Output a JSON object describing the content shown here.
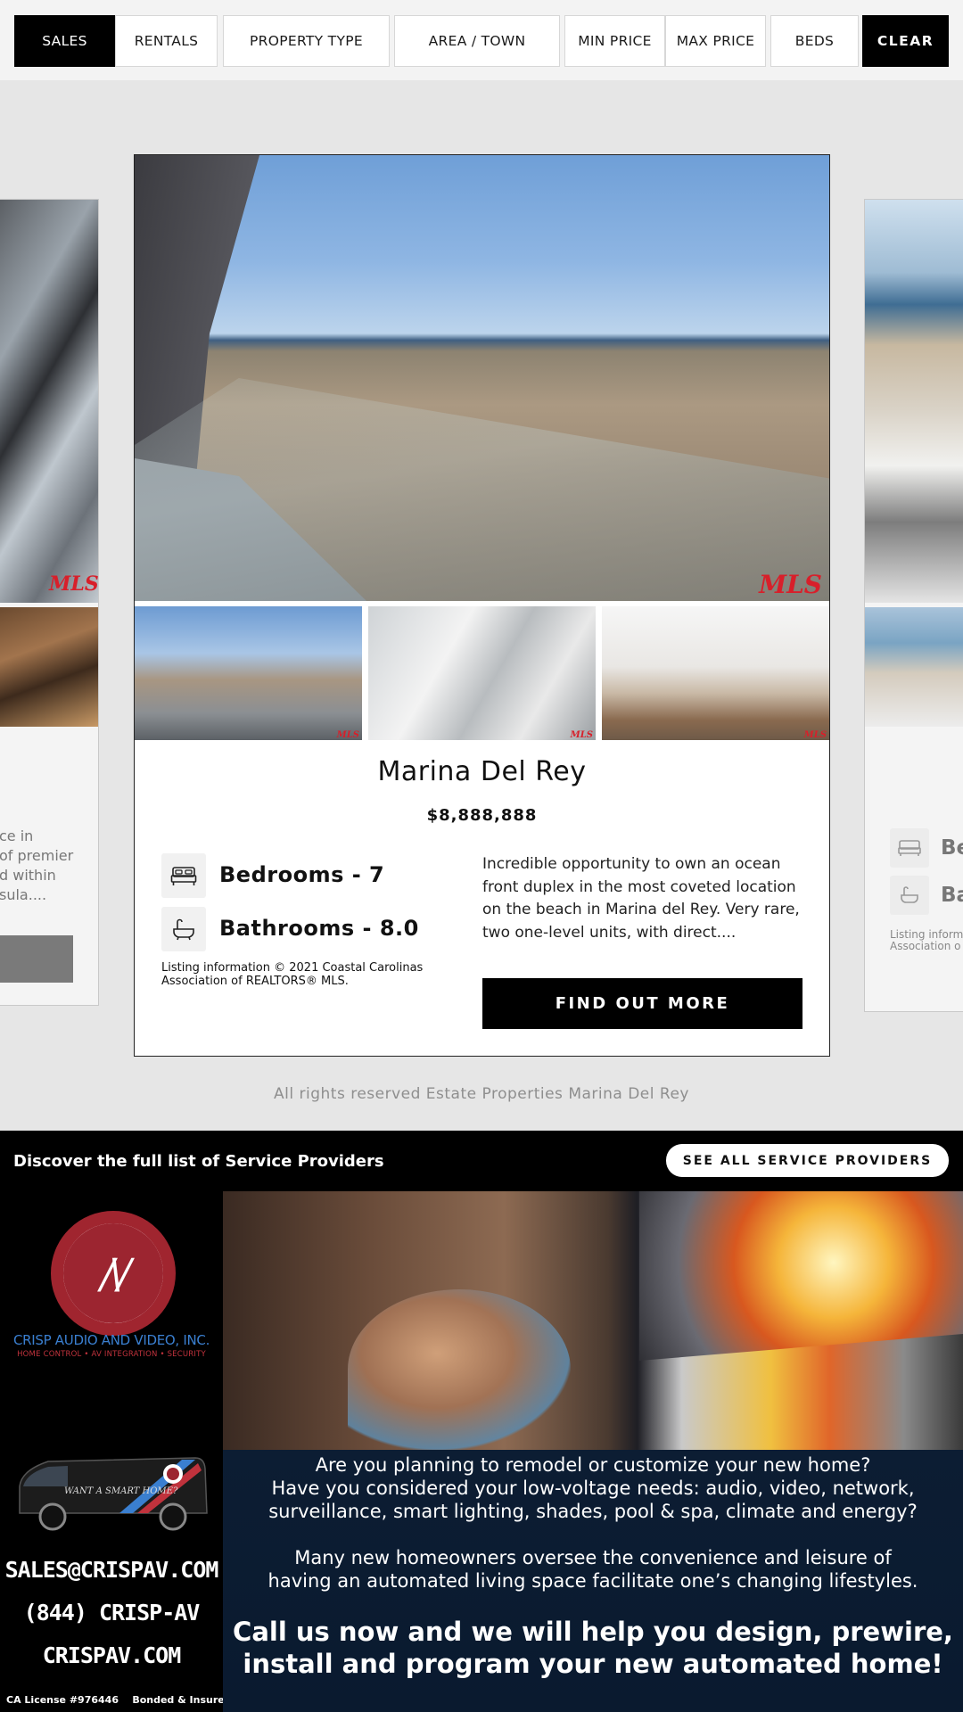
{
  "filters": {
    "sales": "SALES",
    "rentals": "RENTALS",
    "property_type": "PROPERTY TYPE",
    "area_town": "AREA / TOWN",
    "min_price": "MIN PRICE",
    "max_price": "MAX PRICE",
    "beds": "BEDS",
    "clear": "CLEAR"
  },
  "listing": {
    "title": "Marina Del Rey",
    "price": "$8,888,888",
    "bedrooms_label": "Bedrooms - 7",
    "bathrooms_label": "Bathrooms - 8.0",
    "disclaimer": "Listing information © 2021 Coastal Carolinas Association of REALTORS® MLS.",
    "description": "Incredible opportunity to own an ocean front duplex in the most coveted location on the beach in Marina del Rey. Very rare, two one-level units, with direct....",
    "cta": "FIND OUT MORE",
    "watermark": "MLS"
  },
  "peek_left": {
    "lines": [
      "ce in",
      "of premier",
      "d within",
      "sula...."
    ]
  },
  "peek_right": {
    "bed": "Be",
    "bath": "Ba",
    "small_1": "Listing inform",
    "small_2": "Association o"
  },
  "footer": {
    "rights": "All rights reserved Estate Properties Marina Del Rey"
  },
  "service_providers": {
    "text": "Discover the full list of Service Providers",
    "button": "SEE ALL SERVICE PROVIDERS"
  },
  "ad": {
    "logo_mark": "/\\/",
    "company": "CRISP AUDIO AND VIDEO, INC.",
    "tagline": "HOME CONTROL • AV INTEGRATION • SECURITY",
    "van_text": "WANT A SMART HOME?",
    "email": "SALES@CRISPAV.COM",
    "phone": "(844) CRISP-AV",
    "website": "CRISPAV.COM",
    "license": "CA License #976446",
    "bonded": "Bonded & Insured",
    "lines": [
      "Are you planning to remodel or customize your new home?",
      "Have you considered your low-voltage needs: audio, video, network,",
      "surveillance, smart lighting, shades, pool & spa, climate and energy?",
      "Many new homeowners oversee the convenience and leisure of",
      "having an automated living space facilitate one’s changing lifestyles."
    ],
    "headline": [
      "Call us now and we will help you design, prewire,",
      "install and program your new automated home!"
    ]
  },
  "colors": {
    "accent": "#000000",
    "brand_red": "#9c2530",
    "brand_blue": "#3a7fd0",
    "mls_red": "#d81f2a"
  },
  "icons": {
    "bed": "bed-icon",
    "bath": "bathtub-icon"
  }
}
